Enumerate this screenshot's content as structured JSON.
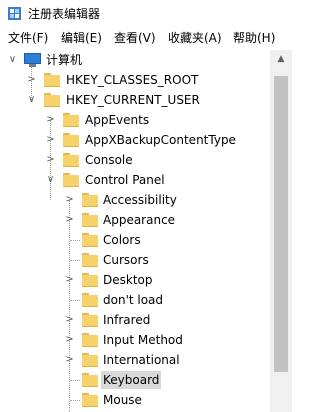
{
  "window": {
    "title": "注册表编辑器",
    "icon": "regedit-icon"
  },
  "menu": [
    "文件(F)",
    "编辑(E)",
    "查看(V)",
    "收藏夹(A)",
    "帮助(H)"
  ],
  "tree": {
    "root": "计算机",
    "nodes": [
      {
        "label": "HKEY_CLASSES_ROOT",
        "expander": ">"
      },
      {
        "label": "HKEY_CURRENT_USER",
        "expander": "v"
      },
      {
        "label": "AppEvents",
        "expander": ">"
      },
      {
        "label": "AppXBackupContentType",
        "expander": ">"
      },
      {
        "label": "Console",
        "expander": ">"
      },
      {
        "label": "Control Panel",
        "expander": "v"
      },
      {
        "label": "Accessibility",
        "expander": ">"
      },
      {
        "label": "Appearance",
        "expander": ">"
      },
      {
        "label": "Colors",
        "expander": ""
      },
      {
        "label": "Cursors",
        "expander": ""
      },
      {
        "label": "Desktop",
        "expander": ">"
      },
      {
        "label": "don't load",
        "expander": ""
      },
      {
        "label": "Infrared",
        "expander": ">"
      },
      {
        "label": "Input Method",
        "expander": ">"
      },
      {
        "label": "International",
        "expander": ">"
      },
      {
        "label": "Keyboard",
        "expander": "",
        "selected": true
      },
      {
        "label": "Mouse",
        "expander": ""
      }
    ]
  },
  "scrollbar": {
    "up_icon": "chevron-up-icon"
  }
}
